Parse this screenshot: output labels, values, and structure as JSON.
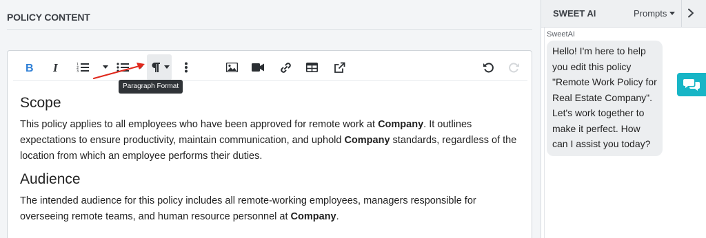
{
  "left": {
    "section_title": "POLICY CONTENT"
  },
  "toolbar": {
    "buttons": [
      {
        "name": "bold",
        "icon": "bold-icon"
      },
      {
        "name": "italic",
        "icon": "italic-icon"
      },
      {
        "name": "ordered-list",
        "icon": "ordered-list-icon"
      },
      {
        "name": "unordered-list",
        "icon": "unordered-list-icon"
      },
      {
        "name": "paragraph-format",
        "icon": "paragraph-icon"
      },
      {
        "name": "more",
        "icon": "more-vertical-icon"
      },
      {
        "name": "insert-image",
        "icon": "image-icon"
      },
      {
        "name": "insert-video",
        "icon": "video-icon"
      },
      {
        "name": "insert-link",
        "icon": "link-icon"
      },
      {
        "name": "insert-table",
        "icon": "table-icon"
      },
      {
        "name": "open-external",
        "icon": "external-link-icon"
      },
      {
        "name": "undo",
        "icon": "undo-icon"
      },
      {
        "name": "redo",
        "icon": "redo-icon"
      }
    ],
    "accent_color": "#2e7fd6",
    "tooltip": "Paragraph Format",
    "annotation_arrow_color": "#e0281c"
  },
  "content": {
    "scope_heading": "Scope",
    "scope_p1": "This policy applies to all employees who have been approved for remote work at ",
    "company": "Company",
    "scope_p2": ". It outlines expectations to ensure productivity, maintain communication, and uphold ",
    "scope_p3": " standards, regardless of the location from which an employee performs their duties.",
    "audience_heading": "Audience",
    "aud_p1": "The intended audience for this policy includes all remote-working employees, managers responsible for overseeing remote teams, and human resource personnel at ",
    "aud_p2": "."
  },
  "assistant": {
    "title": "SWEET AI",
    "prompts_label": "Prompts",
    "sender": "SweetAI",
    "message": "Hello! I'm here to help you edit this policy \"Remote Work Policy for Real Estate Company\". Let's work together to make it perfect. How can I assist you today?",
    "fab_color": "#17b5c6"
  }
}
